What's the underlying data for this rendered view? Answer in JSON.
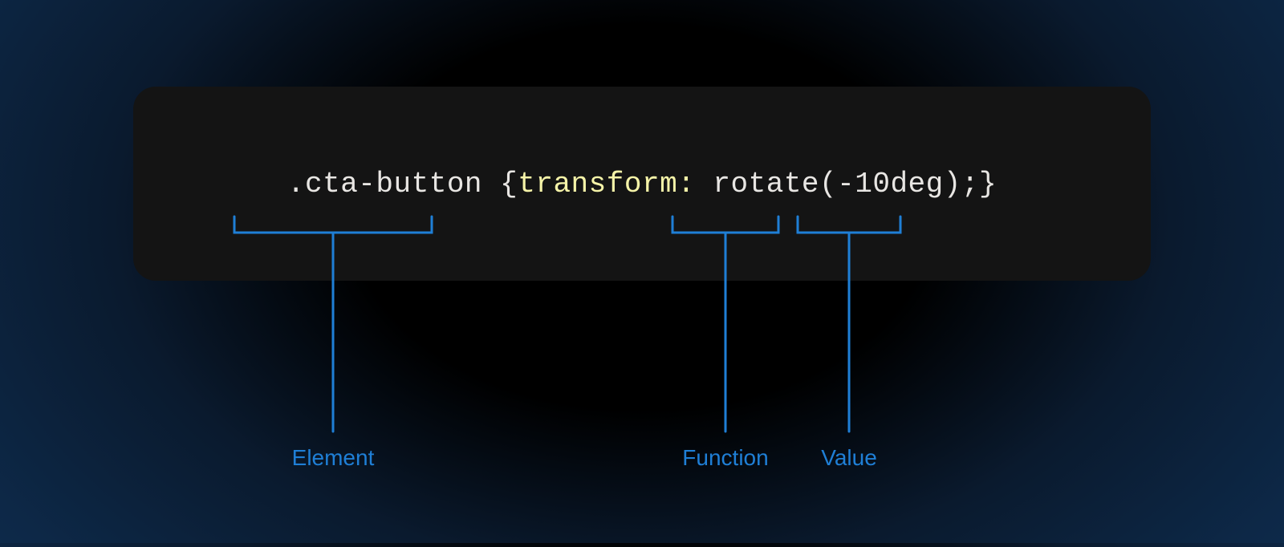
{
  "code": {
    "selector": ".cta-button",
    "brace_open": " {",
    "property": "transform:",
    "space1": " ",
    "function_name": "rotate",
    "paren_open": "(",
    "value": "-10deg",
    "paren_close": ")",
    "semicolon": ";",
    "brace_close": "}"
  },
  "annotations": {
    "element": "Element",
    "function": "Function",
    "value": "Value"
  },
  "colors": {
    "highlight": "#1f7fd6",
    "property_token": "#f5f3a8",
    "code_text": "#e8e6e3",
    "code_bg": "#141414"
  }
}
